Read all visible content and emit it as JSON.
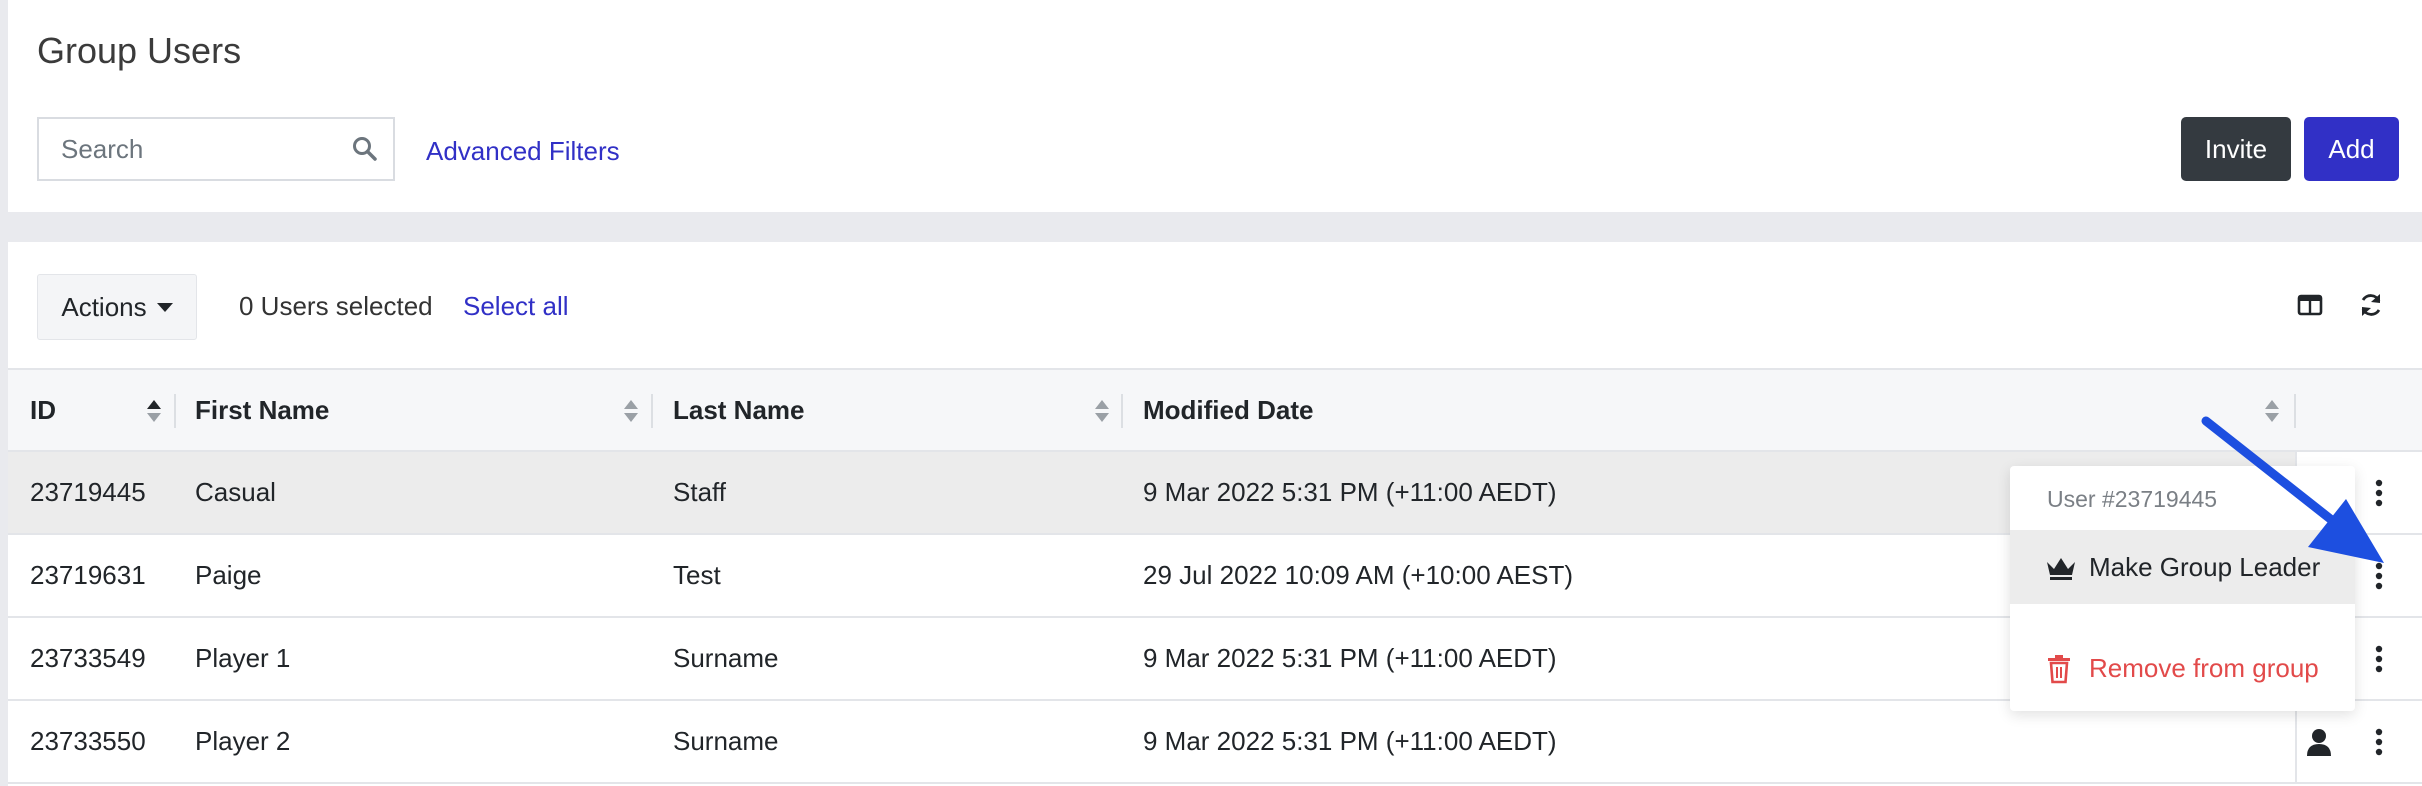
{
  "header": {
    "title": "Group Users",
    "search_placeholder": "Search",
    "advanced_filters": "Advanced Filters",
    "invite_label": "Invite",
    "add_label": "Add"
  },
  "toolbar": {
    "actions_label": "Actions",
    "selected_count": "0 Users selected",
    "select_all": "Select all",
    "icons": [
      "columns-icon",
      "refresh-icon"
    ]
  },
  "table": {
    "columns": [
      "ID",
      "First Name",
      "Last Name",
      "Modified Date"
    ],
    "sorted_column": "ID",
    "sort_direction": "ascending",
    "rows": [
      {
        "id": "23719445",
        "first": "Casual",
        "last": "Staff",
        "modified": "9 Mar 2022 5:31 PM (+11:00 AEDT)"
      },
      {
        "id": "23719631",
        "first": "Paige",
        "last": "Test",
        "modified": "29 Jul 2022 10:09 AM (+10:00 AEST)"
      },
      {
        "id": "23733549",
        "first": "Player 1",
        "last": "Surname",
        "modified": "9 Mar 2022 5:31 PM (+11:00 AEDT)"
      },
      {
        "id": "23733550",
        "first": "Player 2",
        "last": "Surname",
        "modified": "9 Mar 2022 5:31 PM (+11:00 AEDT)"
      }
    ]
  },
  "dropdown": {
    "header": "User #23719445",
    "make_leader": "Make Group Leader",
    "remove": "Remove from group"
  },
  "colors": {
    "accent": "#3130c6",
    "dark_button": "#343a40",
    "danger": "#e24a4a",
    "arrow": "#1d4fe0"
  }
}
